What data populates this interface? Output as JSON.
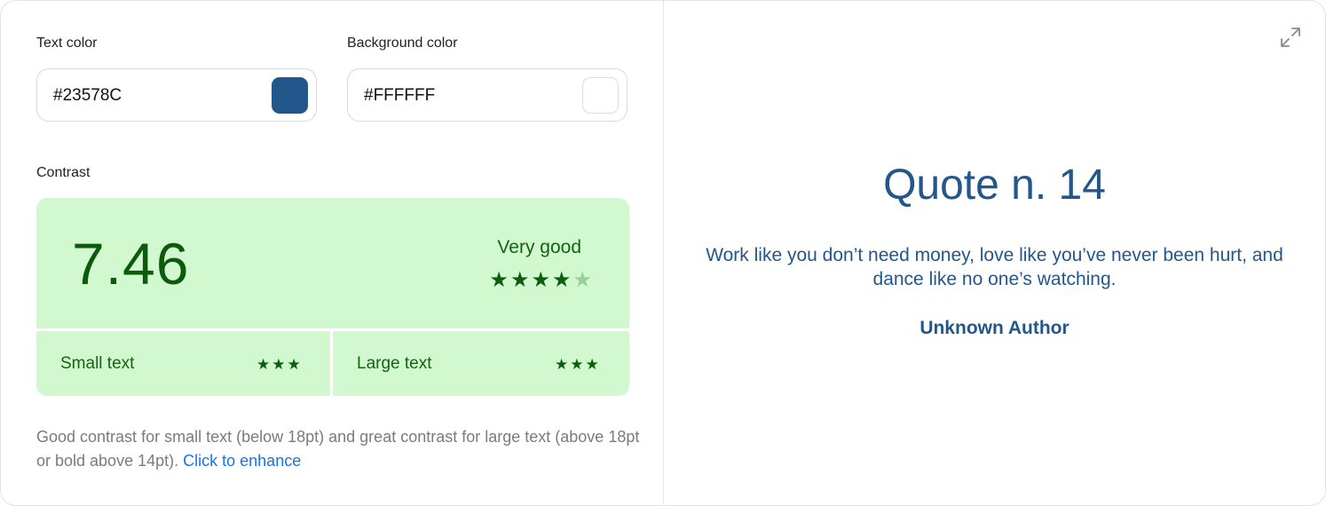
{
  "text_color": {
    "label": "Text color",
    "value": "#23578C",
    "swatch": "#23578C"
  },
  "background_color": {
    "label": "Background color",
    "value": "#FFFFFF",
    "swatch": "#FFFFFF"
  },
  "contrast": {
    "label": "Contrast",
    "ratio": "7.46",
    "rating": "Very good",
    "stars": 4,
    "stars_max": 5,
    "small_text": {
      "label": "Small text",
      "stars": 3
    },
    "large_text": {
      "label": "Large text",
      "stars": 3
    },
    "panel_color": "#D2F8CF",
    "star_color": "#0D5F0D"
  },
  "note": {
    "text": "Good contrast for small text (below 18pt) and great contrast for large text (above 18pt or bold above 14pt).",
    "link": "Click to enhance"
  },
  "preview": {
    "expand_icon": "expand-icon",
    "title": "Quote n. 14",
    "quote": "Work like you don’t need money, love like you’ve never been hurt, and dance like no one’s watching.",
    "author": "Unknown Author"
  }
}
